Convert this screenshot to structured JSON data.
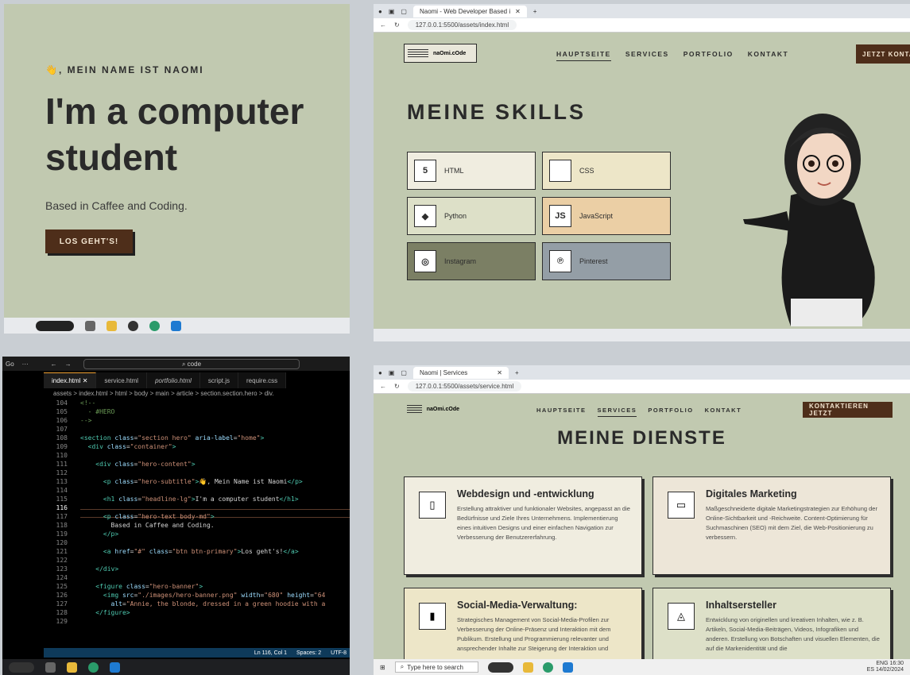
{
  "hero": {
    "subtitle": "👋, MEIN NAME IST NAOMI",
    "headline": "I'm a computer student",
    "text": "Based in Caffee and Coding.",
    "button": "LOS GEHT'S!"
  },
  "browser1": {
    "tab_title": "Naomi - Web Developer Based i",
    "url": "127.0.0.1:5500/assets/index.html",
    "logo": "naOmi.cOde",
    "nav": [
      "HAUPTSEITE",
      "SERVICES",
      "PORTFOLIO",
      "KONTAKT"
    ],
    "cta": "JETZT KONTAKTIEREN",
    "skills_title": "MEINE SKILLS",
    "skills": [
      {
        "label": "HTML",
        "icon": "html5-icon",
        "glyph": "5",
        "bg": "#f0ede0"
      },
      {
        "label": "CSS",
        "icon": "css-icon",
        "glyph": "",
        "bg": "#ede6c8"
      },
      {
        "label": "Python",
        "icon": "python-icon",
        "glyph": "◆",
        "bg": "#dde0c8"
      },
      {
        "label": "JavaScript",
        "icon": "javascript-icon",
        "glyph": "JS",
        "bg": "#ebcfa5"
      },
      {
        "label": "Instagram",
        "icon": "instagram-icon",
        "glyph": "◎",
        "bg": "#7b7f64"
      },
      {
        "label": "Pinterest",
        "icon": "pinterest-icon",
        "glyph": "℗",
        "bg": "#949ea6"
      }
    ]
  },
  "editor": {
    "menu_go": "Go",
    "menu_dots": "···",
    "search": "code",
    "tabs": [
      "index.html",
      "service.html",
      "portfolio.html",
      "script.js",
      "require.css"
    ],
    "breadcrumb": "assets > index.html > html > body > main > article > section.section.hero > div.",
    "line_numbers": [
      "104",
      "105",
      "106",
      "107",
      "108",
      "109",
      "110",
      "111",
      "112",
      "113",
      "114",
      "115",
      "116",
      "117",
      "118",
      "119",
      "120",
      "121",
      "122",
      "123",
      "124",
      "125",
      "126",
      "127",
      "128",
      "129"
    ],
    "status_pos": "Ln 116, Col 1",
    "status_spaces": "Spaces: 2",
    "status_enc": "UTF-8"
  },
  "browser2": {
    "tab_title": "Naomi | Services",
    "url": "127.0.0.1:5500/assets/service.html",
    "logo": "naOmi.cOde",
    "nav": [
      "HAUPTSEITE",
      "SERVICES",
      "PORTFOLIO",
      "KONTAKT"
    ],
    "cta": "KONTAKTIEREN JETZT",
    "title": "MEINE DIENSTE",
    "services": [
      {
        "title": "Webdesign und -entwicklung",
        "text": "Erstellung attraktiver und funktionaler Websites, angepasst an die Bedürfnisse und Ziele Ihres Unternehmens. Implementierung eines intuitiven Designs und einer einfachen Navigation zur Verbesserung der Benutzererfahrung.",
        "glyph": "▯",
        "bg": "#f0ede0"
      },
      {
        "title": "Digitales Marketing",
        "text": "Maßgeschneiderte digitale Marketingstrategien zur Erhöhung der Online-Sichtbarkeit und -Reichweite. Content-Optimierung für Suchmaschinen (SEO) mit dem Ziel, die Web-Positionierung zu verbessern.",
        "glyph": "▭",
        "bg": "#ede6d8"
      },
      {
        "title": "Social-Media-Verwaltung:",
        "text": "Strategisches Management von Social-Media-Profilen zur Verbesserung der Online-Präsenz und Interaktion mit dem Publikum. Erstellung und Programmierung relevanter und ansprechender Inhalte zur Steigerung der Interaktion und",
        "glyph": "▮",
        "bg": "#ede6c8"
      },
      {
        "title": "Inhaltsersteller",
        "text": "Entwicklung von originellen und kreativen Inhalten, wie z. B. Artikeln, Social-Media-Beiträgen, Videos, Infografiken und anderen. Erstellung von Botschaften und visuellen Elementen, die auf die Markenidentität und die",
        "glyph": "◬",
        "bg": "#dde0c8"
      }
    ],
    "taskbar_search": "Type here to search",
    "tray_lang": "ENG",
    "tray_region": "ES",
    "tray_time": "16:30",
    "tray_date": "14/02/2024"
  }
}
